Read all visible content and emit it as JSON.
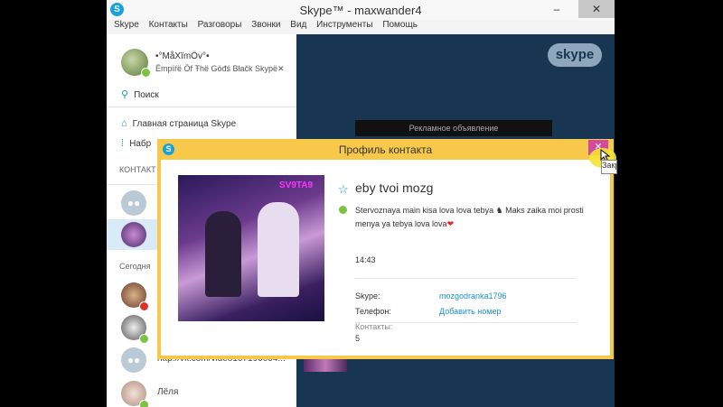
{
  "window": {
    "title": "Skype™ - maxwander4"
  },
  "menu": [
    "Skype",
    "Контакты",
    "Разговоры",
    "Звонки",
    "Вид",
    "Инструменты",
    "Помощь"
  ],
  "profile": {
    "name": "•°MåXïmÖv°•",
    "mood": "Ëmpïŕë Öf Ŧhë Göđś Błačk Skypë✕"
  },
  "sidebar": {
    "search": "Поиск",
    "home": "Главная страница Skype",
    "fav": "Набр",
    "contacts_header": "КОНТАКТ",
    "today_header": "Сегодня",
    "recent": [
      {
        "label": ""
      },
      {
        "label": ""
      },
      {
        "label": "http://vk.com/video107190004..."
      },
      {
        "label": "Лёля"
      }
    ]
  },
  "main": {
    "ad_label": "Рекламное объявление",
    "logo": "skype"
  },
  "dialog": {
    "title": "Профиль контакта",
    "close": "✕",
    "contact_name": "eby tvoi mozg",
    "mood_line1": "Stervoznaya main kisa lova lova tebya ",
    "mood_icon": "♞",
    "mood_line1b": " Maks zaika moi prosti",
    "mood_line2": "menya ya tebya lova lova",
    "mood_heart": "❤",
    "time": "14:43",
    "skype_label": "Skype:",
    "skype_value": "mozgodranka1796",
    "phone_label": "Телефон:",
    "phone_value": "Добавить номер",
    "contacts_label": "Контакты:",
    "contacts_value": "5",
    "photo_text": "SV9TA9"
  },
  "tooltip": "Закрыть",
  "colors": {
    "accent": "#1a8fcf",
    "dialog_frame": "#f7c84a",
    "close": "#d14a9c",
    "main_bg": "#183651"
  }
}
